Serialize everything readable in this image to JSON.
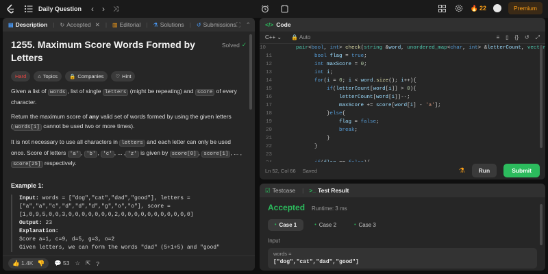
{
  "nav": {
    "title": "Daily Question",
    "streak": "22",
    "premium": "Premium"
  },
  "left": {
    "tabs": [
      {
        "label": "Description"
      },
      {
        "label": "Accepted"
      },
      {
        "label": "Editorial"
      },
      {
        "label": "Solutions"
      },
      {
        "label": "Submissions"
      }
    ],
    "title": "1255. Maximum Score Words Formed by Letters",
    "solved": "Solved",
    "chips": {
      "difficulty": "Hard",
      "topics": "Topics",
      "companies": "Companies",
      "hint": "Hint"
    },
    "example_title": "Example 1:",
    "example": {
      "input_label": "Input:",
      "input_l1": " words = [\"dog\",\"cat\",\"dad\",\"good\"], letters =",
      "input_l2": "[\"a\",\"a\",\"c\",\"d\",\"d\",\"d\",\"g\",\"o\",\"o\"], score =",
      "input_l3": "[1,0,9,5,0,0,3,0,0,0,0,0,0,0,2,0,0,0,0,0,0,0,0,0,0,0]",
      "output_label": "Output:",
      "output_val": " 23",
      "explanation_label": "Explanation:",
      "exp_l1": "Score  a=1, c=9, d=5, g=3, o=2",
      "exp_l2": "Given letters, we can form the words \"dad\" (5+1+5) and \"good\""
    },
    "footer": {
      "likes": "1.4K",
      "comments": "53"
    }
  },
  "code": {
    "header": "Code",
    "language": "C++",
    "auto": "Auto",
    "status": "Ln 52, Col 66",
    "saved": "Saved",
    "run": "Run",
    "submit": "Submit",
    "lines": [
      {
        "n": "10"
      },
      {
        "n": "11"
      },
      {
        "n": "12"
      },
      {
        "n": "13"
      },
      {
        "n": "14"
      },
      {
        "n": "15"
      },
      {
        "n": "16"
      },
      {
        "n": "17"
      },
      {
        "n": "18"
      },
      {
        "n": "19"
      },
      {
        "n": "20"
      },
      {
        "n": "21"
      },
      {
        "n": "22"
      },
      {
        "n": "23"
      },
      {
        "n": "24"
      },
      {
        "n": "25"
      }
    ]
  },
  "result": {
    "tabs": [
      {
        "label": "Testcase"
      },
      {
        "label": "Test Result"
      }
    ],
    "status": "Accepted",
    "runtime": "Runtime: 3 ms",
    "cases": [
      "Case 1",
      "Case 2",
      "Case 3"
    ],
    "input_label": "Input",
    "input_key": "words =",
    "input_value": "[\"dog\",\"cat\",\"dad\",\"good\"]"
  }
}
